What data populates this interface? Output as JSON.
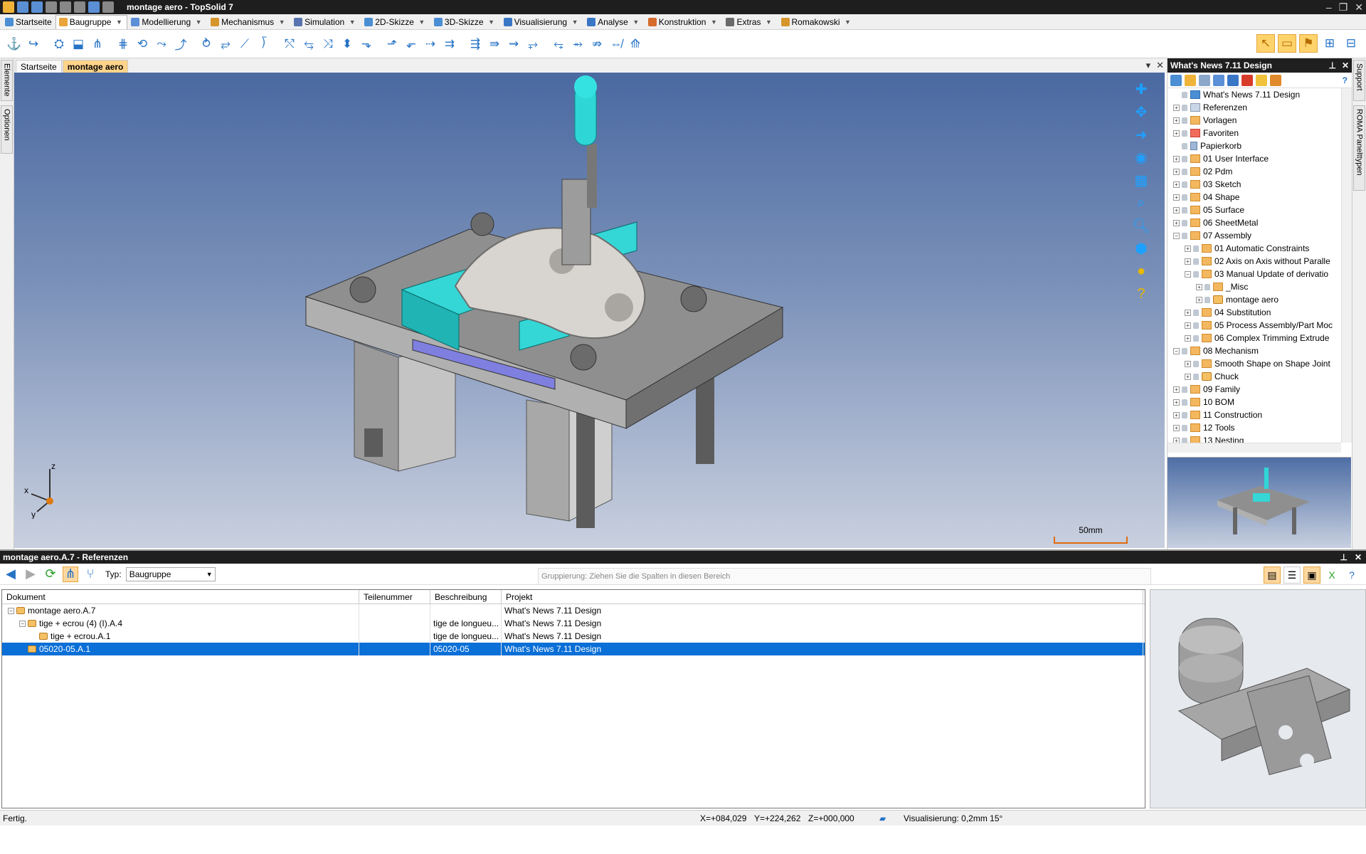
{
  "window": {
    "title": "montage aero - TopSolid 7"
  },
  "menu": {
    "tabs": [
      {
        "label": "Startseite",
        "color": "#4b8ed4"
      },
      {
        "label": "Baugruppe",
        "color": "#e9a53a"
      },
      {
        "label": "Modellierung",
        "color": "#5b8fd6"
      },
      {
        "label": "Mechanismus",
        "color": "#d6962b"
      },
      {
        "label": "Simulation",
        "color": "#5874b0"
      },
      {
        "label": "2D-Skizze",
        "color": "#4b8ed4"
      },
      {
        "label": "3D-Skizze",
        "color": "#4b8ed4"
      },
      {
        "label": "Visualisierung",
        "color": "#3a76c6"
      },
      {
        "label": "Analyse",
        "color": "#3a76c6"
      },
      {
        "label": "Konstruktion",
        "color": "#d66b2b"
      },
      {
        "label": "Extras",
        "color": "#6a6a6a"
      },
      {
        "label": "Romakowski",
        "color": "#d6962b"
      }
    ]
  },
  "left_strip": {
    "tab1": "Elemente",
    "tab2": "Optionen"
  },
  "doc_tabs": [
    "Startseite",
    "montage aero"
  ],
  "viewport": {
    "scale_label": "50mm",
    "axis_x": "x",
    "axis_y": "y",
    "axis_z": "z"
  },
  "right_panel": {
    "title": "What's News 7.11 Design",
    "tree": [
      {
        "label": "What's News 7.11 Design",
        "level": 0,
        "icon": "project",
        "exp": ""
      },
      {
        "label": "Referenzen",
        "level": 0,
        "icon": "refs",
        "exp": "+"
      },
      {
        "label": "Vorlagen",
        "level": 0,
        "icon": "folder",
        "exp": "+"
      },
      {
        "label": "Favoriten",
        "level": 0,
        "icon": "fav",
        "exp": "+"
      },
      {
        "label": "Papierkorb",
        "level": 0,
        "icon": "trash",
        "exp": ""
      },
      {
        "label": "01 User Interface",
        "level": 0,
        "icon": "folder",
        "exp": "+"
      },
      {
        "label": "02 Pdm",
        "level": 0,
        "icon": "folder",
        "exp": "+"
      },
      {
        "label": "03 Sketch",
        "level": 0,
        "icon": "folder",
        "exp": "+"
      },
      {
        "label": "04 Shape",
        "level": 0,
        "icon": "folder",
        "exp": "+"
      },
      {
        "label": "05 Surface",
        "level": 0,
        "icon": "folder",
        "exp": "+"
      },
      {
        "label": "06 SheetMetal",
        "level": 0,
        "icon": "folder",
        "exp": "+"
      },
      {
        "label": "07 Assembly",
        "level": 0,
        "icon": "folder",
        "exp": "−"
      },
      {
        "label": "01 Automatic Constraints",
        "level": 1,
        "icon": "folder",
        "exp": "+"
      },
      {
        "label": "02 Axis on Axis without Paralle",
        "level": 1,
        "icon": "folder",
        "exp": "+"
      },
      {
        "label": "03 Manual Update of derivatio",
        "level": 1,
        "icon": "folder",
        "exp": "−"
      },
      {
        "label": "_Misc",
        "level": 2,
        "icon": "folder",
        "exp": "+"
      },
      {
        "label": "montage aero",
        "level": 2,
        "icon": "asm",
        "exp": "+"
      },
      {
        "label": "04 Substitution",
        "level": 1,
        "icon": "folder",
        "exp": "+"
      },
      {
        "label": "05 Process Assembly/Part Moc",
        "level": 1,
        "icon": "folder",
        "exp": "+"
      },
      {
        "label": "06 Complex Trimming Extrude",
        "level": 1,
        "icon": "folder",
        "exp": "+"
      },
      {
        "label": "08 Mechanism",
        "level": 0,
        "icon": "folder",
        "exp": "−"
      },
      {
        "label": "Smooth Shape on Shape Joint",
        "level": 1,
        "icon": "folder",
        "exp": "+"
      },
      {
        "label": "Chuck",
        "level": 1,
        "icon": "asm",
        "exp": "+"
      },
      {
        "label": "09 Family",
        "level": 0,
        "icon": "folder",
        "exp": "+"
      },
      {
        "label": "10 BOM",
        "level": 0,
        "icon": "folder",
        "exp": "+"
      },
      {
        "label": "11 Construction",
        "level": 0,
        "icon": "folder",
        "exp": "+"
      },
      {
        "label": "12 Tools",
        "level": 0,
        "icon": "folder",
        "exp": "+"
      },
      {
        "label": "13 Nesting",
        "level": 0,
        "icon": "folder",
        "exp": "+"
      }
    ]
  },
  "right_strip": {
    "tab1": "Support",
    "tab2": "ROMA Panelttypen"
  },
  "bottom_panel": {
    "title": "montage aero.A.7 - Referenzen",
    "typ_label": "Typ:",
    "typ_value": "Baugruppe",
    "grouping_placeholder": "Gruppierung:  Ziehen Sie die Spalten in diesen Bereich",
    "columns": [
      "Dokument",
      "Teilenummer",
      "Beschreibung",
      "Projekt"
    ],
    "rows": [
      {
        "doc": "montage aero.A.7",
        "part": "",
        "desc": "",
        "proj": "What's News 7.11 Design",
        "indent": 0,
        "sel": false
      },
      {
        "doc": "tige  + ecrou (4) (I).A.4",
        "part": "",
        "desc": "tige de longueu...",
        "proj": "What's News 7.11 Design",
        "indent": 1,
        "sel": false
      },
      {
        "doc": "tige  + ecrou.A.1",
        "part": "",
        "desc": "tige de longueu...",
        "proj": "What's News 7.11 Design",
        "indent": 2,
        "sel": false
      },
      {
        "doc": "05020-05.A.1",
        "part": "",
        "desc": "05020-05",
        "proj": "What's News 7.11 Design",
        "indent": 1,
        "sel": true
      }
    ]
  },
  "status": {
    "text": "Fertig.",
    "x": "X=+084,029",
    "y": "Y=+224,262",
    "z": "Z=+000,000",
    "vis": "Visualisierung: 0,2mm 15°"
  }
}
